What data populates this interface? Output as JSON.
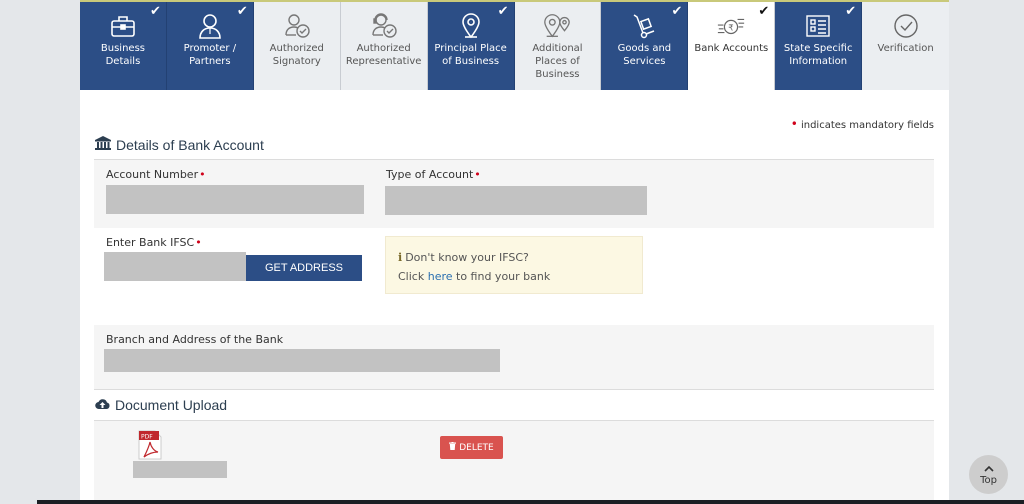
{
  "tabs": [
    {
      "label": "Business Details",
      "state": "done",
      "icon": "briefcase-icon",
      "checked": true
    },
    {
      "label": "Promoter / Partners",
      "state": "done",
      "icon": "person-icon",
      "checked": true
    },
    {
      "label": "Authorized Signatory",
      "state": "pending",
      "icon": "person-check-icon",
      "checked": false
    },
    {
      "label": "Authorized Representative",
      "state": "pending",
      "icon": "headset-person-icon",
      "checked": false
    },
    {
      "label": "Principal Place of Business",
      "state": "done",
      "icon": "location-pin-icon",
      "checked": true
    },
    {
      "label": "Additional Places of Business",
      "state": "pending",
      "icon": "double-pin-icon",
      "checked": false
    },
    {
      "label": "Goods and Services",
      "state": "done",
      "icon": "hand-truck-icon",
      "checked": true
    },
    {
      "label": "Bank Accounts",
      "state": "active",
      "icon": "rupee-coin-icon",
      "checked": true
    },
    {
      "label": "State Specific Information",
      "state": "done",
      "icon": "info-card-icon",
      "checked": true
    },
    {
      "label": "Verification",
      "state": "pending",
      "icon": "check-circle-icon",
      "checked": false
    }
  ],
  "check_glyph": "✔",
  "mandatory_note": "indicates mandatory fields",
  "bank_section": {
    "title": "Details of Bank Account",
    "account_number_label": "Account Number",
    "account_number_value": "",
    "type_of_account_label": "Type of Account",
    "type_of_account_value": "",
    "ifsc_label": "Enter Bank IFSC",
    "ifsc_value": "",
    "get_address_label": "GET ADDRESS",
    "info_line1": "Don't know your IFSC?",
    "info_click": "Click",
    "info_link": "here",
    "info_rest": "to find your bank",
    "branch_label": "Branch and Address of the Bank",
    "branch_value": ""
  },
  "upload_section": {
    "title": "Document Upload",
    "file_type_badge": "PDF",
    "file_name": "",
    "delete_label": "DELETE"
  },
  "top_button": {
    "label": "Top"
  },
  "colors": {
    "primary": "#2c4e86",
    "danger": "#d9534f",
    "required": "#d0021b",
    "info_bg": "#fcf8e3"
  }
}
